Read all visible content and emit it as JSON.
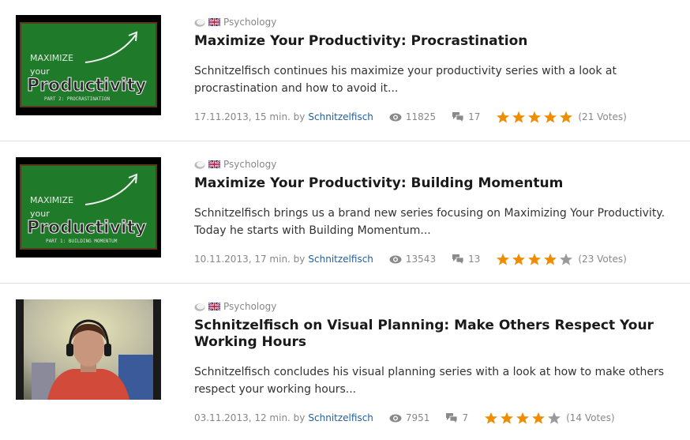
{
  "videos": [
    {
      "category": "Psychology",
      "title": "Maximize Your Productivity: Procrastination",
      "description": "Schnitzelfisch continues his maximize your productivity series with a look at procrastination and how to avoid it...",
      "date_duration": "17.11.2013, 15 min. by",
      "author": "Schnitzelfisch",
      "views": "11825",
      "comments": "17",
      "rating": 5,
      "votes": "(21 Votes)",
      "thumb": {
        "line1": "MAXIMIZE",
        "line2": "your",
        "line3": "Productivity",
        "line4": "PART 2: PROCRASTINATION"
      }
    },
    {
      "category": "Psychology",
      "title": "Maximize Your Productivity: Building Momentum",
      "description": "Schnitzelfisch brings us a brand new series focusing on Maximizing Your Productivity. Today he starts with Building Momentum...",
      "date_duration": "10.11.2013, 17 min. by",
      "author": "Schnitzelfisch",
      "views": "13543",
      "comments": "13",
      "rating": 4,
      "votes": "(23 Votes)",
      "thumb": {
        "line1": "MAXIMIZE",
        "line2": "your",
        "line3": "Productivity",
        "line4": "PART 1: BUILDING MOMENTUM"
      }
    },
    {
      "category": "Psychology",
      "title": "Schnitzelfisch on Visual Planning: Make Others Respect Your Working Hours",
      "description": "Schnitzelfisch concludes his visual planning series with a look at how to make others respect your working hours...",
      "date_duration": "03.11.2013, 12 min. by",
      "author": "Schnitzelfisch",
      "views": "7951",
      "comments": "7",
      "rating": 4,
      "votes": "(14 Votes)"
    }
  ],
  "colors": {
    "star_on": "#f08c00",
    "star_off": "#9a9a9a",
    "link": "#1f5f9f",
    "chalkboard": "#1f7a2a"
  }
}
